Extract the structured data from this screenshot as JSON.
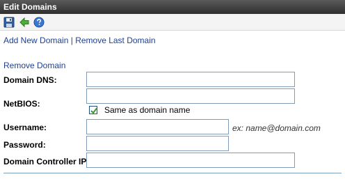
{
  "window": {
    "title": "Edit Domains"
  },
  "toolbar": {
    "icons": [
      "save-icon",
      "back-arrow-icon",
      "help-icon"
    ]
  },
  "links": {
    "add_new_domain": "Add New Domain",
    "separator": "|",
    "remove_last_domain": "Remove Last Domain",
    "remove_domain": "Remove Domain"
  },
  "form": {
    "domain_dns": {
      "label": "Domain DNS:",
      "value": ""
    },
    "netbios": {
      "label": "NetBIOS:",
      "value": ""
    },
    "same_as_domain": {
      "label": "Same as domain name",
      "checked": true
    },
    "username": {
      "label": "Username:",
      "value": "",
      "hint": "ex: name@domain.com"
    },
    "password": {
      "label": "Password:",
      "value": ""
    },
    "dc_ip": {
      "label": "Domain Controller IP:",
      "value": ""
    }
  },
  "colors": {
    "link": "#1f3f8f",
    "titlebar": "#3f3f3f",
    "input_border": "#7f9db9",
    "checkmark": "#2e9e2e"
  }
}
